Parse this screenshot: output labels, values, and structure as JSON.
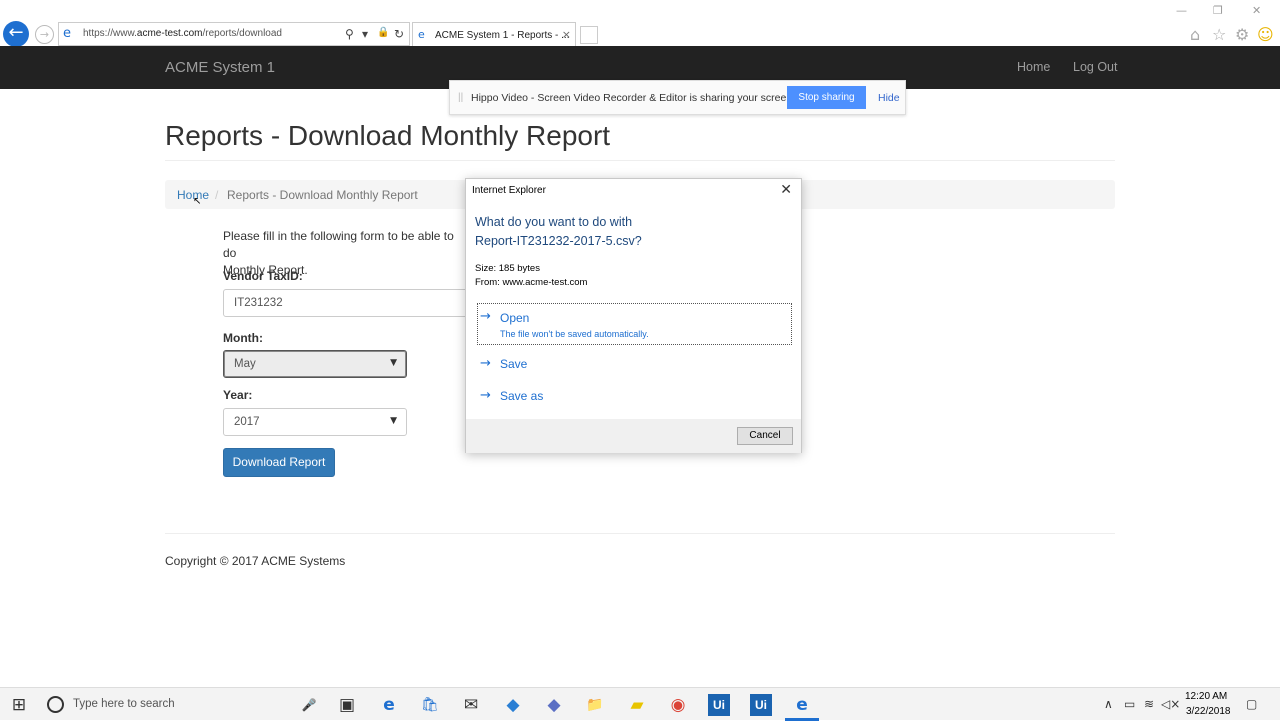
{
  "browser": {
    "url_prefix": "https://www.",
    "url_domain": "acme-test.com",
    "url_path": "/reports/download",
    "tab_title": "ACME System 1 - Reports - ...",
    "tab_close": "×",
    "back_glyph": "←",
    "forward_glyph": "→",
    "ie_glyph": "e",
    "search_glyph": "⚲",
    "dropdown_glyph": "▾",
    "lock_glyph": "🔒",
    "refresh_glyph": "↻",
    "minimize_glyph": "—",
    "restore_glyph": "❐",
    "close_glyph": "✕",
    "home_glyph": "⌂",
    "star_glyph": "☆",
    "gear_glyph": "⚙",
    "smiley_glyph": "☺"
  },
  "navbar": {
    "brand": "ACME System 1",
    "links": [
      "Home",
      "Log Out"
    ]
  },
  "share_bar": {
    "grip": "||",
    "text": "Hippo Video - Screen Video Recorder & Editor is sharing your screen.",
    "stop_label": "Stop sharing",
    "hide_label": "Hide"
  },
  "page": {
    "title": "Reports - Download Monthly Report",
    "breadcrumb": {
      "home": "Home",
      "separator": "/",
      "current": "Reports - Download Monthly Report"
    },
    "form": {
      "intro_line1": "Please fill in the following form to be able to do",
      "intro_line2": "Monthly Report.",
      "vendor_label": "Vendor TaxID:",
      "vendor_value": "IT231232",
      "month_label": "Month:",
      "month_value": "May",
      "year_label": "Year:",
      "year_value": "2017",
      "caret": "▼",
      "submit_label": "Download Report"
    },
    "copyright": "Copyright © 2017 ACME Systems"
  },
  "dialog": {
    "title": "Internet Explorer",
    "close": "✕",
    "question_line1": "What do you want to do with",
    "question_line2": "Report-IT231232-2017-5.csv?",
    "size": "Size: 185 bytes",
    "from": "From: www.acme-test.com",
    "arrow": "→",
    "open_label": "Open",
    "open_sub": "The file won't be saved automatically.",
    "save_label": "Save",
    "save_as_label": "Save as",
    "cancel_label": "Cancel"
  },
  "taskbar": {
    "start_glyph": "⊞",
    "search_placeholder": "Type here to search",
    "mic_glyph": "🎤",
    "task_view_glyph": "▣",
    "edge_glyph": "e",
    "store_glyph": "🛍",
    "mail_glyph": "✉",
    "app_glyph": "◆",
    "folder_glyph": "📁",
    "note_glyph": "▰",
    "chrome_glyph": "◉",
    "uipath_label": "Ui",
    "ie_glyph": "e",
    "tray_up": "∧",
    "battery_glyph": "▭",
    "wifi_glyph": "≋",
    "volume_glyph": "◁×",
    "notify_glyph": "▢",
    "time": "12:20 AM",
    "date": "3/22/2018"
  },
  "colors": {
    "navbar_bg": "#222222",
    "primary": "#337ab7",
    "ie_blue": "#1e6fd0",
    "share_button": "#4d90fe"
  }
}
